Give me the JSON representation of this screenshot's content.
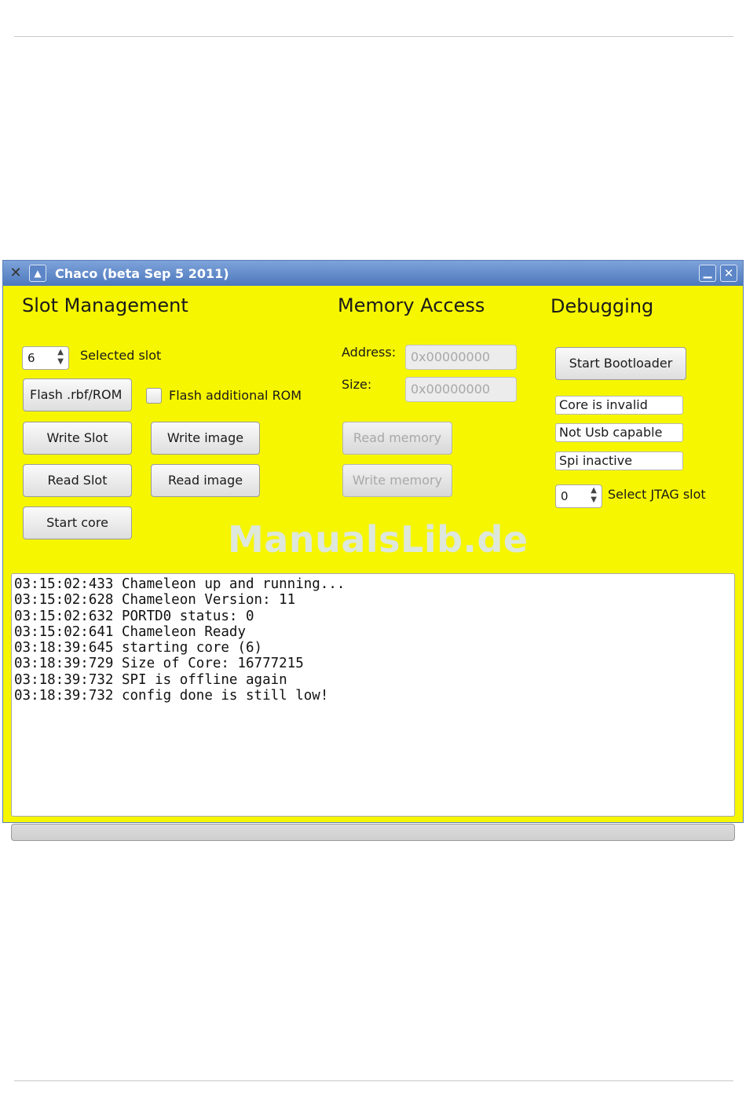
{
  "window": {
    "title": "Chaco (beta Sep  5 2011)",
    "background_color": "#f6f600",
    "titlebar_color": "#4d78bd"
  },
  "slot_management": {
    "heading": "Slot Management",
    "selected_slot_value": "6",
    "selected_slot_label": "Selected slot",
    "flash_button": "Flash .rbf/ROM",
    "flash_additional_rom_label": "Flash additional ROM",
    "flash_additional_rom_checked": false,
    "write_slot_button": "Write Slot",
    "write_image_button": "Write image",
    "read_slot_button": "Read Slot",
    "read_image_button": "Read image",
    "start_core_button": "Start core"
  },
  "memory_access": {
    "heading": "Memory Access",
    "address_label": "Address:",
    "address_value": "0x00000000",
    "size_label": "Size:",
    "size_value": "0x00000000",
    "read_memory_button": "Read memory",
    "write_memory_button": "Write memory"
  },
  "debugging": {
    "heading": "Debugging",
    "start_bootloader_button": "Start Bootloader",
    "core_status": "Core is invalid",
    "usb_status": "Not Usb capable",
    "spi_status": "Spi inactive",
    "jtag_slot_value": "0",
    "jtag_slot_label": "Select JTAG slot"
  },
  "watermark": "ManualsLib.de",
  "log_lines": [
    "03:15:02:433 Chameleon up and running...",
    "03:15:02:628 Chameleon Version: 11",
    "03:15:02:632 PORTD0 status: 0",
    "03:15:02:641 Chameleon Ready",
    "03:18:39:645 starting core (6)",
    "03:18:39:729 Size of Core: 16777215",
    "03:18:39:732 SPI is offline again",
    "03:18:39:732 config done is still low!"
  ],
  "progress_fraction": 0
}
